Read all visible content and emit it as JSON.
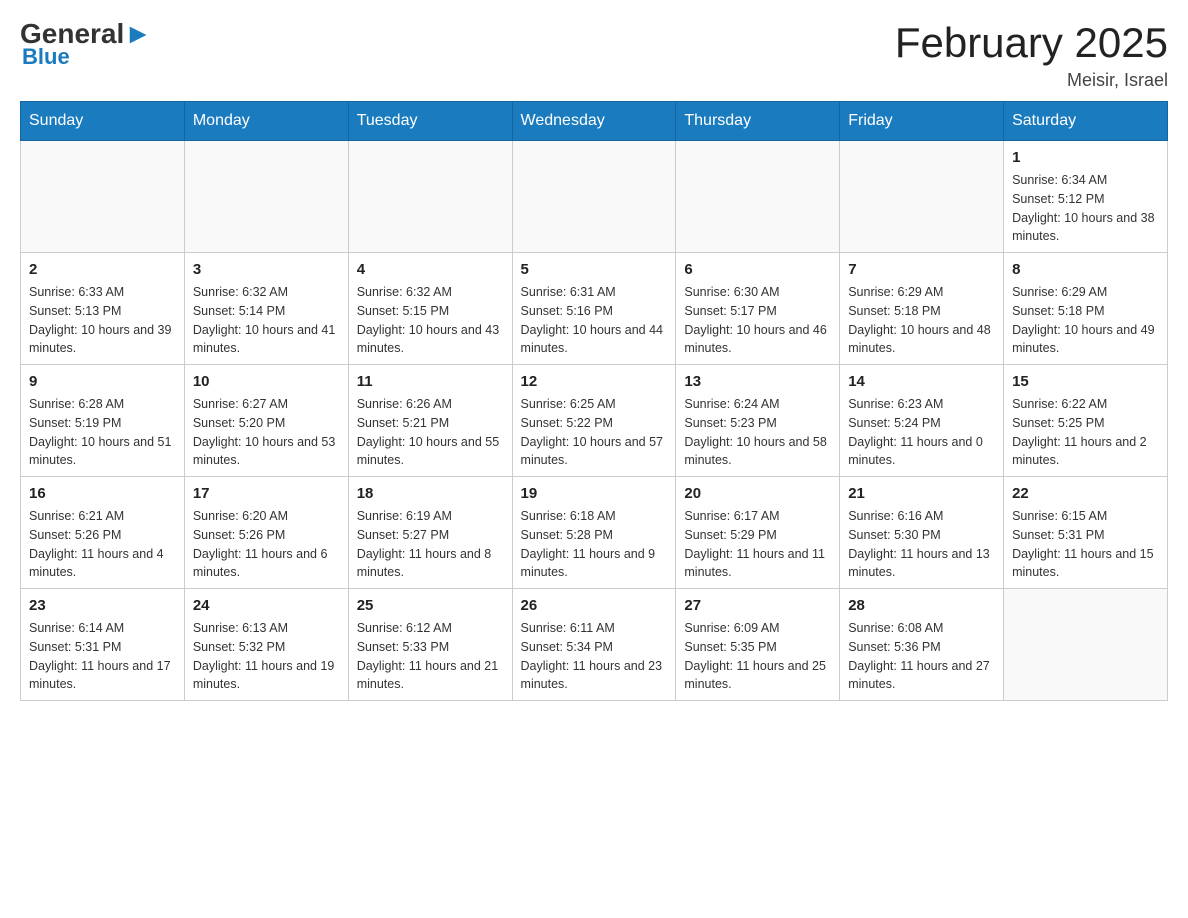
{
  "logo": {
    "general": "General",
    "blue": "Blue"
  },
  "title": "February 2025",
  "subtitle": "Meisir, Israel",
  "days_of_week": [
    "Sunday",
    "Monday",
    "Tuesday",
    "Wednesday",
    "Thursday",
    "Friday",
    "Saturday"
  ],
  "weeks": [
    [
      {
        "day": "",
        "sunrise": "",
        "sunset": "",
        "daylight": ""
      },
      {
        "day": "",
        "sunrise": "",
        "sunset": "",
        "daylight": ""
      },
      {
        "day": "",
        "sunrise": "",
        "sunset": "",
        "daylight": ""
      },
      {
        "day": "",
        "sunrise": "",
        "sunset": "",
        "daylight": ""
      },
      {
        "day": "",
        "sunrise": "",
        "sunset": "",
        "daylight": ""
      },
      {
        "day": "",
        "sunrise": "",
        "sunset": "",
        "daylight": ""
      },
      {
        "day": "1",
        "sunrise": "Sunrise: 6:34 AM",
        "sunset": "Sunset: 5:12 PM",
        "daylight": "Daylight: 10 hours and 38 minutes."
      }
    ],
    [
      {
        "day": "2",
        "sunrise": "Sunrise: 6:33 AM",
        "sunset": "Sunset: 5:13 PM",
        "daylight": "Daylight: 10 hours and 39 minutes."
      },
      {
        "day": "3",
        "sunrise": "Sunrise: 6:32 AM",
        "sunset": "Sunset: 5:14 PM",
        "daylight": "Daylight: 10 hours and 41 minutes."
      },
      {
        "day": "4",
        "sunrise": "Sunrise: 6:32 AM",
        "sunset": "Sunset: 5:15 PM",
        "daylight": "Daylight: 10 hours and 43 minutes."
      },
      {
        "day": "5",
        "sunrise": "Sunrise: 6:31 AM",
        "sunset": "Sunset: 5:16 PM",
        "daylight": "Daylight: 10 hours and 44 minutes."
      },
      {
        "day": "6",
        "sunrise": "Sunrise: 6:30 AM",
        "sunset": "Sunset: 5:17 PM",
        "daylight": "Daylight: 10 hours and 46 minutes."
      },
      {
        "day": "7",
        "sunrise": "Sunrise: 6:29 AM",
        "sunset": "Sunset: 5:18 PM",
        "daylight": "Daylight: 10 hours and 48 minutes."
      },
      {
        "day": "8",
        "sunrise": "Sunrise: 6:29 AM",
        "sunset": "Sunset: 5:18 PM",
        "daylight": "Daylight: 10 hours and 49 minutes."
      }
    ],
    [
      {
        "day": "9",
        "sunrise": "Sunrise: 6:28 AM",
        "sunset": "Sunset: 5:19 PM",
        "daylight": "Daylight: 10 hours and 51 minutes."
      },
      {
        "day": "10",
        "sunrise": "Sunrise: 6:27 AM",
        "sunset": "Sunset: 5:20 PM",
        "daylight": "Daylight: 10 hours and 53 minutes."
      },
      {
        "day": "11",
        "sunrise": "Sunrise: 6:26 AM",
        "sunset": "Sunset: 5:21 PM",
        "daylight": "Daylight: 10 hours and 55 minutes."
      },
      {
        "day": "12",
        "sunrise": "Sunrise: 6:25 AM",
        "sunset": "Sunset: 5:22 PM",
        "daylight": "Daylight: 10 hours and 57 minutes."
      },
      {
        "day": "13",
        "sunrise": "Sunrise: 6:24 AM",
        "sunset": "Sunset: 5:23 PM",
        "daylight": "Daylight: 10 hours and 58 minutes."
      },
      {
        "day": "14",
        "sunrise": "Sunrise: 6:23 AM",
        "sunset": "Sunset: 5:24 PM",
        "daylight": "Daylight: 11 hours and 0 minutes."
      },
      {
        "day": "15",
        "sunrise": "Sunrise: 6:22 AM",
        "sunset": "Sunset: 5:25 PM",
        "daylight": "Daylight: 11 hours and 2 minutes."
      }
    ],
    [
      {
        "day": "16",
        "sunrise": "Sunrise: 6:21 AM",
        "sunset": "Sunset: 5:26 PM",
        "daylight": "Daylight: 11 hours and 4 minutes."
      },
      {
        "day": "17",
        "sunrise": "Sunrise: 6:20 AM",
        "sunset": "Sunset: 5:26 PM",
        "daylight": "Daylight: 11 hours and 6 minutes."
      },
      {
        "day": "18",
        "sunrise": "Sunrise: 6:19 AM",
        "sunset": "Sunset: 5:27 PM",
        "daylight": "Daylight: 11 hours and 8 minutes."
      },
      {
        "day": "19",
        "sunrise": "Sunrise: 6:18 AM",
        "sunset": "Sunset: 5:28 PM",
        "daylight": "Daylight: 11 hours and 9 minutes."
      },
      {
        "day": "20",
        "sunrise": "Sunrise: 6:17 AM",
        "sunset": "Sunset: 5:29 PM",
        "daylight": "Daylight: 11 hours and 11 minutes."
      },
      {
        "day": "21",
        "sunrise": "Sunrise: 6:16 AM",
        "sunset": "Sunset: 5:30 PM",
        "daylight": "Daylight: 11 hours and 13 minutes."
      },
      {
        "day": "22",
        "sunrise": "Sunrise: 6:15 AM",
        "sunset": "Sunset: 5:31 PM",
        "daylight": "Daylight: 11 hours and 15 minutes."
      }
    ],
    [
      {
        "day": "23",
        "sunrise": "Sunrise: 6:14 AM",
        "sunset": "Sunset: 5:31 PM",
        "daylight": "Daylight: 11 hours and 17 minutes."
      },
      {
        "day": "24",
        "sunrise": "Sunrise: 6:13 AM",
        "sunset": "Sunset: 5:32 PM",
        "daylight": "Daylight: 11 hours and 19 minutes."
      },
      {
        "day": "25",
        "sunrise": "Sunrise: 6:12 AM",
        "sunset": "Sunset: 5:33 PM",
        "daylight": "Daylight: 11 hours and 21 minutes."
      },
      {
        "day": "26",
        "sunrise": "Sunrise: 6:11 AM",
        "sunset": "Sunset: 5:34 PM",
        "daylight": "Daylight: 11 hours and 23 minutes."
      },
      {
        "day": "27",
        "sunrise": "Sunrise: 6:09 AM",
        "sunset": "Sunset: 5:35 PM",
        "daylight": "Daylight: 11 hours and 25 minutes."
      },
      {
        "day": "28",
        "sunrise": "Sunrise: 6:08 AM",
        "sunset": "Sunset: 5:36 PM",
        "daylight": "Daylight: 11 hours and 27 minutes."
      },
      {
        "day": "",
        "sunrise": "",
        "sunset": "",
        "daylight": ""
      }
    ]
  ]
}
